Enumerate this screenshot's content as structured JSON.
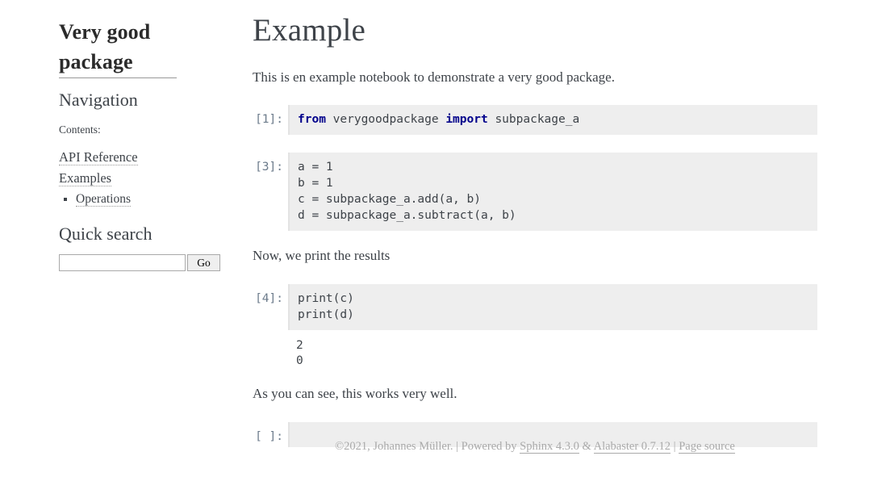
{
  "sidebar": {
    "logo_line1": "Very good",
    "logo_line2": "package",
    "nav_heading": "Navigation",
    "contents_label": "Contents:",
    "toc": [
      {
        "label": "API Reference"
      },
      {
        "label": "Examples"
      }
    ],
    "toc_sub": [
      {
        "label": "Operations"
      }
    ],
    "search_heading": "Quick search",
    "search_value": "",
    "search_placeholder": "",
    "search_button": "Go"
  },
  "main": {
    "title": "Example",
    "intro_paragraph": "This is en example notebook to demonstrate a very good package.",
    "mid_paragraph": "Now, we print the results",
    "end_paragraph": "As you can see, this works very well.",
    "cells": [
      {
        "prompt": "[1]:",
        "code_tokens": [
          {
            "text": "from",
            "type": "keyword"
          },
          {
            "text": " verygoodpackage ",
            "type": "plain"
          },
          {
            "text": "import",
            "type": "keyword"
          },
          {
            "text": " subpackage_a",
            "type": "plain"
          }
        ],
        "code_plain": "from verygoodpackage import subpackage_a"
      },
      {
        "prompt": "[3]:",
        "code_plain": "a = 1\nb = 1\nc = subpackage_a.add(a, b)\nd = subpackage_a.subtract(a, b)"
      },
      {
        "prompt": "[4]:",
        "code_plain": "print(c)\nprint(d)",
        "output": "2\n0"
      },
      {
        "prompt": "[ ]:",
        "code_plain": ""
      }
    ]
  },
  "footer": {
    "copyright": "©2021, Johannes Müller.",
    "sep1": "|",
    "powered_by": "Powered by",
    "sphinx": "Sphinx 4.3.0",
    "amp": "&",
    "alabaster": "Alabaster 0.7.12",
    "sep2": "|",
    "page_source": "Page source"
  },
  "colors": {
    "text": "#3E4349",
    "prompt": "#6c7b8b",
    "cell_bg": "#eeeeee",
    "keyword": "#00008B",
    "number": "#B45141",
    "footer_text": "#aaaaaa"
  }
}
